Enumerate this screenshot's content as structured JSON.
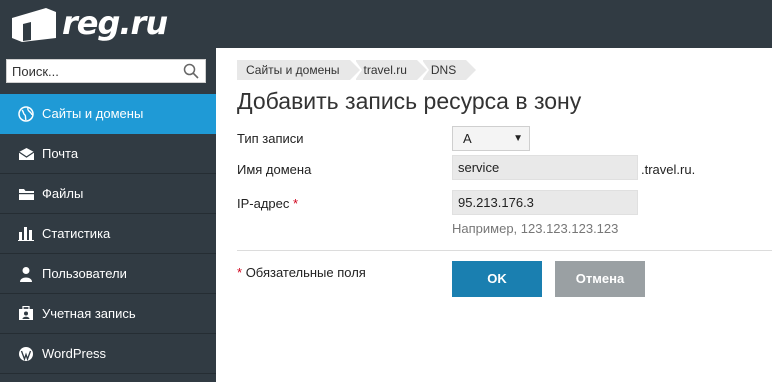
{
  "header": {
    "logo_text": "reg.ru"
  },
  "sidebar": {
    "search_placeholder": "Поиск...",
    "items": [
      {
        "label": "Сайты и домены",
        "icon": "globe-icon",
        "active": true
      },
      {
        "label": "Почта",
        "icon": "mail-icon"
      },
      {
        "label": "Файлы",
        "icon": "folder-icon"
      },
      {
        "label": "Статистика",
        "icon": "bar-chart-icon"
      },
      {
        "label": "Пользователи",
        "icon": "user-icon"
      },
      {
        "label": "Учетная запись",
        "icon": "account-icon"
      },
      {
        "label": "WordPress",
        "icon": "wordpress-icon"
      }
    ]
  },
  "breadcrumbs": [
    "Сайты и домены",
    "travel.ru",
    "DNS"
  ],
  "main": {
    "title": "Добавить запись ресурса в зону",
    "form": {
      "record_type_label": "Тип записи",
      "record_type_value": "A",
      "domain_label": "Имя домена",
      "domain_value": "service",
      "domain_suffix": ".travel.ru.",
      "ip_label": "IP-адрес",
      "ip_value": "95.213.176.3",
      "ip_hint": "Например, 123.123.123.123",
      "required_mark": "*",
      "required_note": "Обязательные поля"
    },
    "buttons": {
      "ok": "OK",
      "cancel": "Отмена"
    }
  },
  "colors": {
    "topbar": "#313b43",
    "sidebar": "#313b43",
    "active_item": "#1f9ad6",
    "ok_button": "#1a7fb0",
    "cancel_button": "#9aa0a3",
    "required": "#d0021b"
  }
}
